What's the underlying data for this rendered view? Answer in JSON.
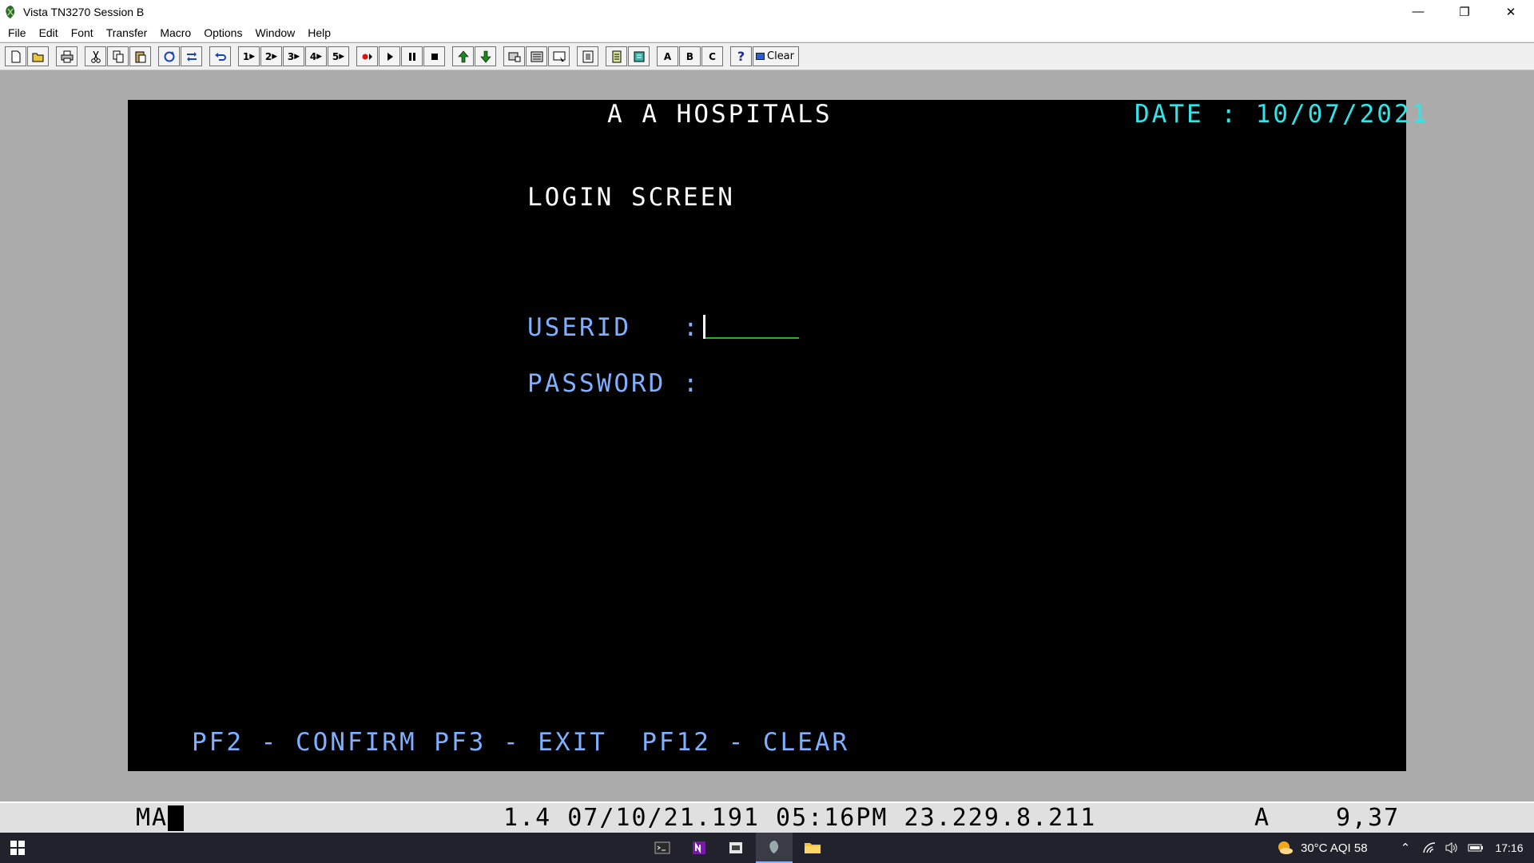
{
  "window": {
    "title": "Vista TN3270 Session B",
    "controls": {
      "minimize": "—",
      "restore": "❐",
      "close": "✕"
    }
  },
  "menu": [
    "File",
    "Edit",
    "Font",
    "Transfer",
    "Macro",
    "Options",
    "Window",
    "Help"
  ],
  "toolbar": {
    "macro_buttons": [
      "1",
      "2",
      "3",
      "4",
      "5"
    ],
    "letter_buttons": [
      "A",
      "B",
      "C"
    ],
    "help_label": "?",
    "clear_label": "Clear"
  },
  "terminal": {
    "header_title": "A A HOSPITALS",
    "date_label": "DATE : 10/07/2021",
    "screen_title": "LOGIN SCREEN",
    "userid_label": "USERID   :",
    "password_label": "PASSWORD :",
    "userid_value": "",
    "password_value": "",
    "function_keys": "PF2 - CONFIRM PF3 - EXIT  PF12 - CLEAR",
    "colors": {
      "background": "#000000",
      "text": "#ffffff",
      "date": "#32e4e8",
      "field_label": "#7fb0ff",
      "input_underline": "#1db81d"
    }
  },
  "status": {
    "mode": "MA",
    "session_info": "1.4 07/10/21.191 05:16PM 23.229.8.211",
    "session_letter": "A",
    "cursor_position": "9,37"
  },
  "taskbar": {
    "weather": "30°C AQI 58",
    "time": "17:16"
  }
}
